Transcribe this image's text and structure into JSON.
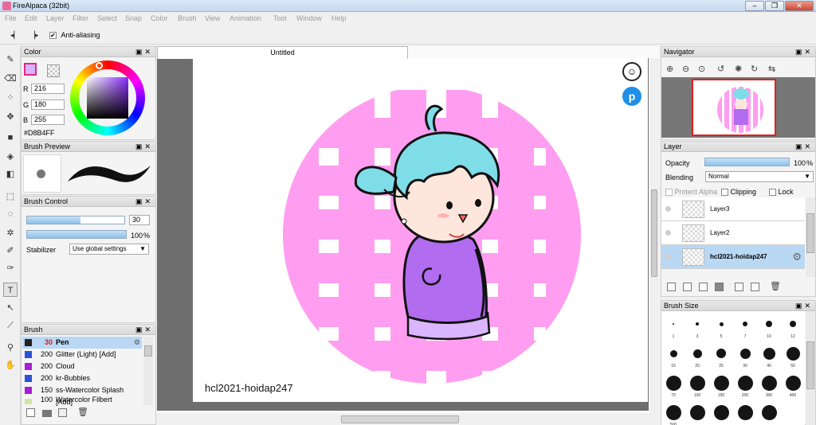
{
  "window": {
    "title": "FireAlpaca (32bit)"
  },
  "menu": [
    "File",
    "Edit",
    "Layer",
    "Filter",
    "Select",
    "Snap",
    "Color",
    "Brush",
    "View",
    "Animation",
    "Tool",
    "Window",
    "Help"
  ],
  "tool_options": {
    "antialias_label": "Anti-aliasing",
    "antialias_checked": true
  },
  "color_panel": {
    "title": "Color",
    "r_label": "R",
    "g_label": "G",
    "b_label": "B",
    "r": "216",
    "g": "180",
    "b": "255",
    "hex": "#D8B4FF",
    "current_color": "#D8B4FF"
  },
  "brush_preview": {
    "title": "Brush Preview"
  },
  "brush_control": {
    "title": "Brush Control",
    "size": "30",
    "opacity": "100",
    "opacity_unit": "%",
    "stabilizer_label": "Stabilizer",
    "stabilizer_value": "Use global settings"
  },
  "brush_list": {
    "title": "Brush",
    "items": [
      {
        "size": "30",
        "name": "Pen",
        "color": "#222222",
        "selected": true
      },
      {
        "size": "200",
        "name": "Glitter (Light) [Add]",
        "color": "#2a52d8"
      },
      {
        "size": "200",
        "name": "Cloud",
        "color": "#a51fd6"
      },
      {
        "size": "200",
        "name": "kr-Bubbles",
        "color": "#2a52d8"
      },
      {
        "size": "150",
        "name": "ss-Watercolor Splash [Add]",
        "color": "#a51fd6"
      },
      {
        "size": "100",
        "name": "Watercolor Filbert",
        "color": "#cfe8a0"
      }
    ]
  },
  "document": {
    "tab": "Untitled",
    "watermark": "hcl2021-hoidap247"
  },
  "navigator": {
    "title": "Navigator"
  },
  "layer_panel": {
    "title": "Layer",
    "opacity_label": "Opacity",
    "opacity": "100",
    "opacity_unit": "%",
    "blending_label": "Blending",
    "blending_value": "Normal",
    "protect_alpha": "Protect Alpha",
    "clipping": "Clipping",
    "lock": "Lock",
    "layers": [
      {
        "name": "Layer3",
        "selected": false
      },
      {
        "name": "Layer2",
        "selected": false
      },
      {
        "name": "hcl2021-hoidap247",
        "selected": true
      }
    ]
  },
  "brush_size": {
    "title": "Brush Size",
    "sizes": [
      "1",
      "3",
      "5",
      "7",
      "10",
      "12",
      "15",
      "20",
      "25",
      "30",
      "40",
      "50",
      "70",
      "100",
      "150",
      "200",
      "300",
      "400",
      "500",
      "",
      "",
      "",
      ""
    ]
  },
  "colors": {
    "accent": "#98c4ea",
    "pink": "#ff9ef0",
    "hair": "#7fdde8",
    "shirt": "#b26cf0"
  }
}
